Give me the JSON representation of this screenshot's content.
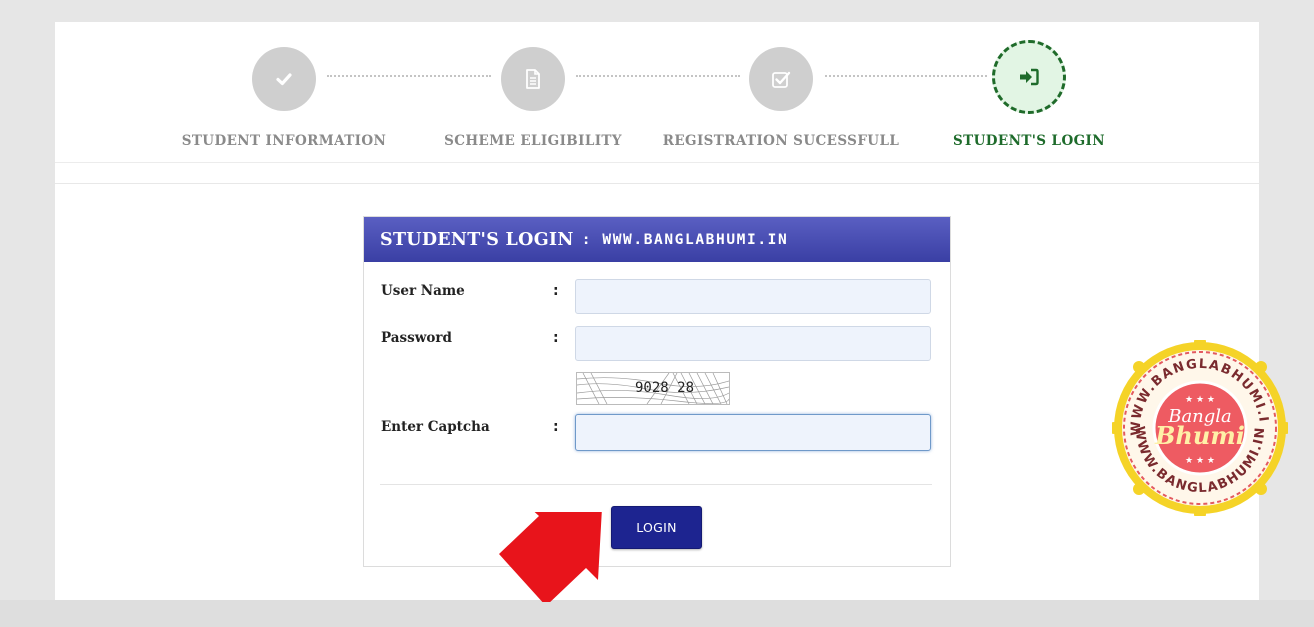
{
  "wizard": {
    "steps": [
      {
        "label": "STUDENT INFORMATION",
        "icon": "check-icon",
        "state": "completed"
      },
      {
        "label": "SCHEME ELIGIBILITY",
        "icon": "document-icon",
        "state": "completed"
      },
      {
        "label": "REGISTRATION SUCESSFULL",
        "icon": "checkbox-icon",
        "state": "completed"
      },
      {
        "label": "STUDENT'S LOGIN",
        "icon": "sign-in-icon",
        "state": "active"
      }
    ]
  },
  "login": {
    "title": "STUDENT'S LOGIN",
    "title_site": ": WWW.BANGLABHUMI.IN",
    "username_label": "User Name",
    "password_label": "Password",
    "captcha_label": "Enter Captcha",
    "colon": ":",
    "username_value": "",
    "password_value": "",
    "captcha_value": "",
    "captcha_text": "9028 28",
    "button_label": "LOGIN"
  },
  "watermark": {
    "brand_top": "Bangla",
    "brand_bottom": "Bhumi",
    "ring_text": "WWW.BANGLABHUMI.IN"
  },
  "colors": {
    "header": "#3f44a8",
    "button": "#1d2490",
    "active_step": "#1e6b2b",
    "inactive_step": "#cfcfcf",
    "arrow": "#e8141b",
    "badge_ring": "#f5d327",
    "badge_center": "#ee5b62"
  }
}
